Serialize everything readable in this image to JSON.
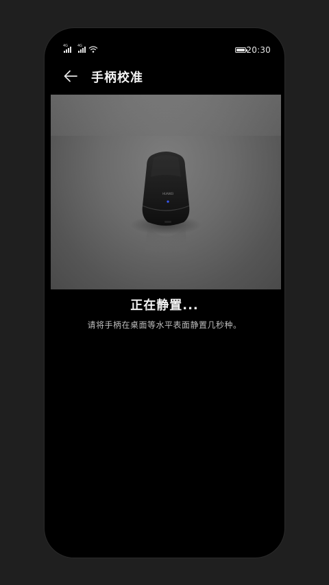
{
  "statusbar": {
    "sim1_tag": "4G",
    "sim2_tag": "4G",
    "time": "20:30"
  },
  "header": {
    "title": "手柄校准",
    "back_icon": "arrow-left-icon"
  },
  "hero": {
    "device_brand": "HUAWEI",
    "indicator_color": "#3a5bff"
  },
  "content": {
    "heading": "正在静置...",
    "description": "请将手柄在桌面等水平表面静置几秒种。"
  }
}
